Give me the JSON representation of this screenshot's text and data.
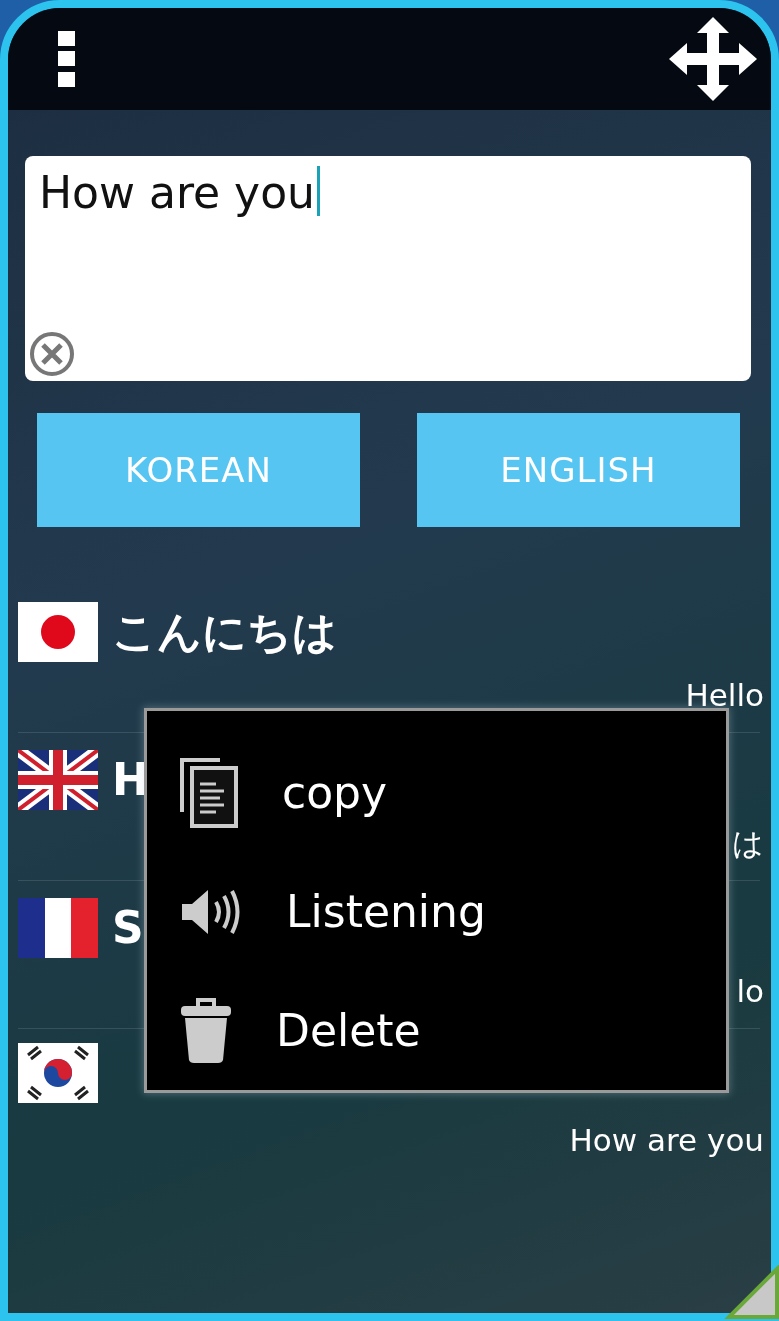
{
  "input": {
    "value": "How are you"
  },
  "language_buttons": [
    {
      "label": "KOREAN"
    },
    {
      "label": "ENGLISH"
    }
  ],
  "history": [
    {
      "kind": "japan",
      "translation": "こんにちは",
      "source": "Hello"
    },
    {
      "kind": "uk",
      "translation": "H",
      "source": "は"
    },
    {
      "kind": "france",
      "translation": "S",
      "source": "lo"
    },
    {
      "kind": "korea",
      "source": "How are you"
    }
  ],
  "context_menu": {
    "items": [
      {
        "kind": "copy",
        "label": "copy"
      },
      {
        "kind": "listen",
        "label": "Listening"
      },
      {
        "kind": "delete",
        "label": "Delete"
      }
    ]
  }
}
